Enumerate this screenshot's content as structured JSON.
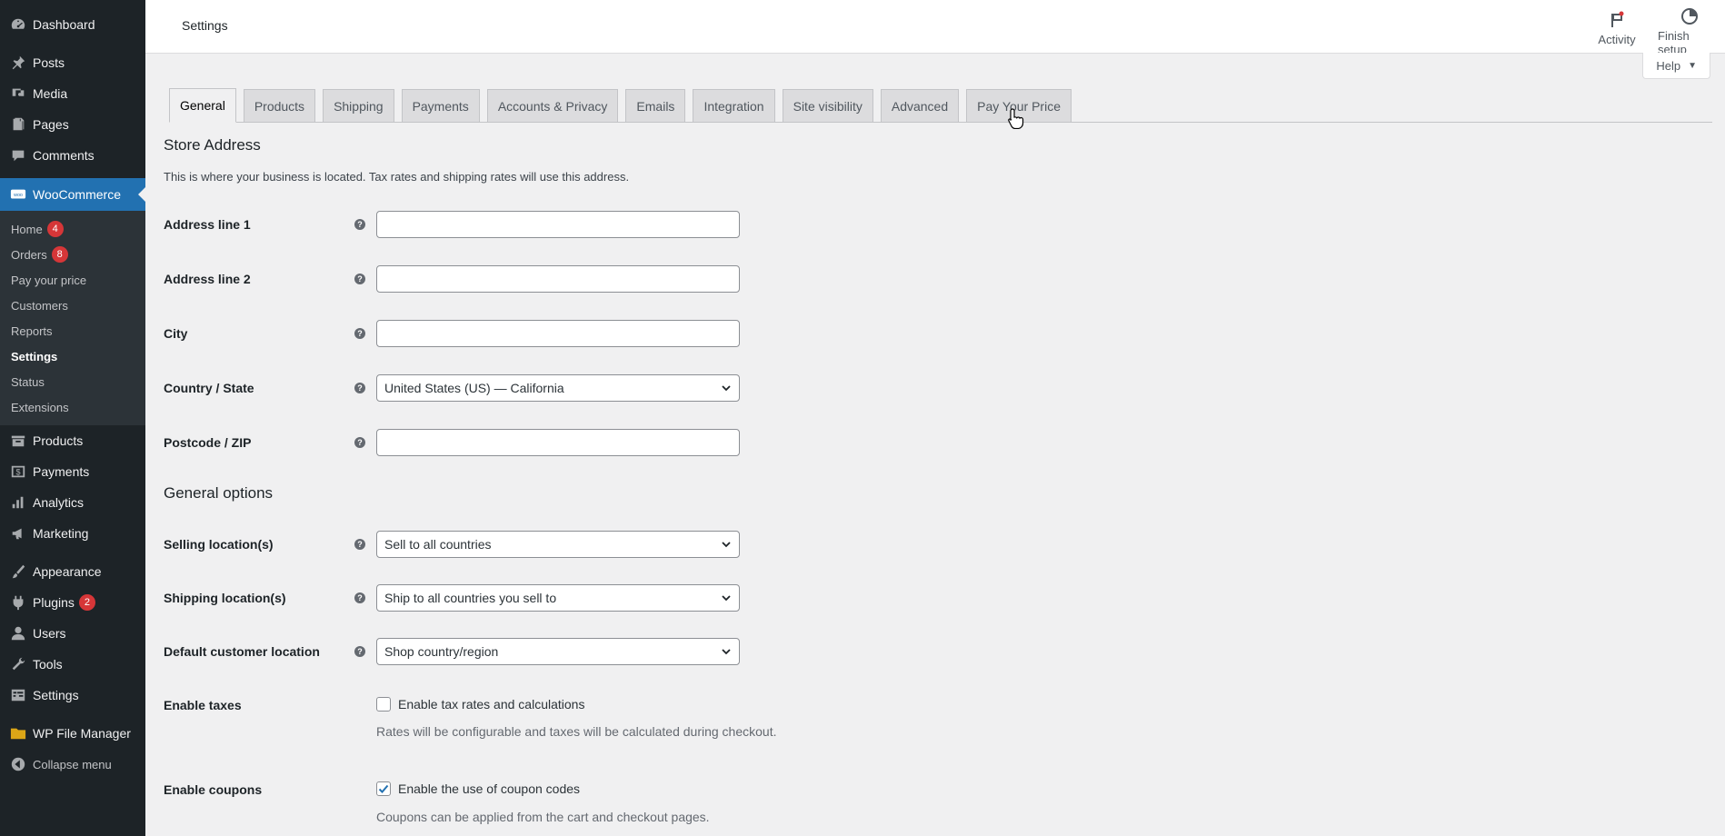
{
  "header": {
    "title": "Settings",
    "activity_label": "Activity",
    "finish_setup_label": "Finish setup",
    "help_label": "Help"
  },
  "sidebar": {
    "items_top": [
      {
        "label": "Dashboard",
        "icon": "dashboard-icon"
      },
      {
        "label": "Posts",
        "icon": "pin-icon"
      },
      {
        "label": "Media",
        "icon": "media-icon"
      },
      {
        "label": "Pages",
        "icon": "page-icon"
      },
      {
        "label": "Comments",
        "icon": "comment-icon"
      }
    ],
    "woocommerce_label": "WooCommerce",
    "woo_sub": [
      {
        "label": "Home",
        "badge": "4"
      },
      {
        "label": "Orders",
        "badge": "8"
      },
      {
        "label": "Pay your price",
        "badge": ""
      },
      {
        "label": "Customers",
        "badge": ""
      },
      {
        "label": "Reports",
        "badge": ""
      },
      {
        "label": "Settings",
        "badge": ""
      },
      {
        "label": "Status",
        "badge": ""
      },
      {
        "label": "Extensions",
        "badge": ""
      }
    ],
    "items_mid": [
      {
        "label": "Products",
        "icon": "archive-icon"
      },
      {
        "label": "Payments",
        "icon": "dollar-icon"
      },
      {
        "label": "Analytics",
        "icon": "bar-chart-icon"
      },
      {
        "label": "Marketing",
        "icon": "megaphone-icon"
      }
    ],
    "items_bottom": [
      {
        "label": "Appearance",
        "icon": "brush-icon"
      },
      {
        "label": "Plugins",
        "icon": "plug-icon",
        "badge": "2"
      },
      {
        "label": "Users",
        "icon": "user-icon"
      },
      {
        "label": "Tools",
        "icon": "wrench-icon"
      },
      {
        "label": "Settings",
        "icon": "settings-icon"
      }
    ],
    "file_manager_label": "WP File Manager",
    "collapse_label": "Collapse menu"
  },
  "tabs": [
    "General",
    "Products",
    "Shipping",
    "Payments",
    "Accounts & Privacy",
    "Emails",
    "Integration",
    "Site visibility",
    "Advanced",
    "Pay Your Price"
  ],
  "store_address": {
    "title": "Store Address",
    "desc": "This is where your business is located. Tax rates and shipping rates will use this address.",
    "address1_label": "Address line 1",
    "address1_value": "",
    "address2_label": "Address line 2",
    "address2_value": "",
    "city_label": "City",
    "city_value": "",
    "country_label": "Country / State",
    "country_value": "United States (US) — California",
    "postcode_label": "Postcode / ZIP",
    "postcode_value": ""
  },
  "general_options": {
    "title": "General options",
    "selling_label": "Selling location(s)",
    "selling_value": "Sell to all countries",
    "shipping_label": "Shipping location(s)",
    "shipping_value": "Ship to all countries you sell to",
    "customer_label": "Default customer location",
    "customer_value": "Shop country/region",
    "taxes_label": "Enable taxes",
    "taxes_check_label": "Enable tax rates and calculations",
    "taxes_checked": false,
    "taxes_help": "Rates will be configurable and taxes will be calculated during checkout.",
    "coupons_label": "Enable coupons",
    "coupons_check_label": "Enable the use of coupon codes",
    "coupons_checked": true,
    "coupons_help": "Coupons can be applied from the cart and checkout pages."
  },
  "colors": {
    "accent": "#2271b1",
    "sidebar_bg": "#1d2327",
    "badge": "#d63638"
  }
}
